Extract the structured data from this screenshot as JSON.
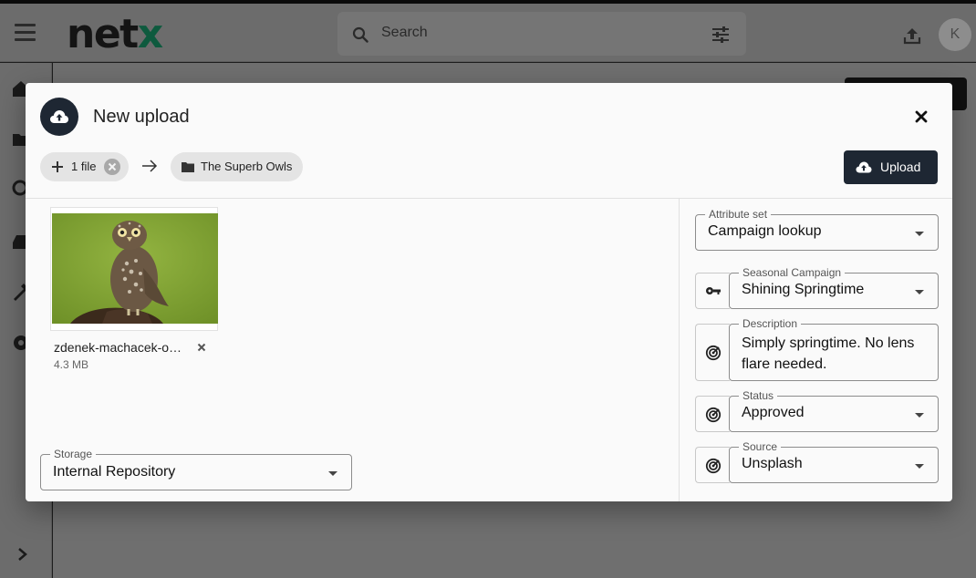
{
  "app": {
    "logo_text": "net",
    "logo_accent": "x",
    "brand_accent_color": "#0e5a3e",
    "search_placeholder": "Search",
    "avatar_initial": "K"
  },
  "modal": {
    "title": "New upload",
    "header_icon": "cloud-upload-icon",
    "files_chip_label": "1 file",
    "destination_folder": "The Superb Owls",
    "upload_button_label": "Upload",
    "primary_color": "#1e2733"
  },
  "file": {
    "name": "zdenek-machacek-o…",
    "size": "4.3 MB"
  },
  "storage": {
    "label": "Storage",
    "value": "Internal Repository"
  },
  "attributes": {
    "attribute_set": {
      "label": "Attribute set",
      "value": "Campaign lookup"
    },
    "fields": [
      {
        "label": "Seasonal Campaign",
        "value": "Shining Springtime",
        "icon": "key-icon"
      },
      {
        "label": "Description",
        "value": "Simply springtime. No lens flare needed.",
        "icon": "radar-icon"
      },
      {
        "label": "Status",
        "value": "Approved",
        "icon": "radar-icon"
      },
      {
        "label": "Source",
        "value": "Unsplash",
        "icon": "radar-icon"
      }
    ]
  }
}
